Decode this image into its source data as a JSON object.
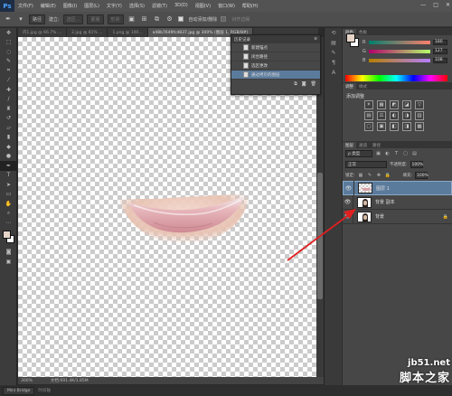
{
  "app": {
    "logo": "Ps"
  },
  "menu": [
    "文件(F)",
    "编辑(E)",
    "图像(I)",
    "图层(L)",
    "文字(Y)",
    "选择(S)",
    "滤镜(T)",
    "3D(D)",
    "视图(V)",
    "窗口(W)",
    "帮助(H)"
  ],
  "window_controls": [
    "—",
    "□",
    "✕"
  ],
  "options": {
    "mode": "路径",
    "make_label": "建立:",
    "btn_select": "选区...",
    "btn_mask": "蒙版",
    "btn_shape": "形状",
    "auto_add_delete": "自动添加/删除",
    "align_edges": "对齐边缘"
  },
  "tabs": [
    {
      "label": "内1.jpg @ 66.7% ...",
      "active": false
    },
    {
      "label": "2.jpg @ 81% ...",
      "active": false
    },
    {
      "label": "1.png @ 100...",
      "active": false
    },
    {
      "label": "a48b7649fcd837.jpg @ 300% (图层 1, RGB/8#)",
      "active": true
    }
  ],
  "status": {
    "zoom": "300%",
    "doc": "文档:691.4K/1.85M"
  },
  "bottom": {
    "mini_bridge": "Mini Bridge",
    "timeline": "时间轴"
  },
  "history": {
    "title": "历史记录",
    "items": [
      {
        "label": "新建锚点",
        "selected": false
      },
      {
        "label": "闭合路径",
        "selected": false
      },
      {
        "label": "选区更改",
        "selected": false
      },
      {
        "label": "通过拷贝的图层",
        "selected": true
      }
    ]
  },
  "color_panel": {
    "tabs": [
      "颜色",
      "色板"
    ],
    "r": "180",
    "g": "127",
    "b": "108"
  },
  "adjust_panel": {
    "tabs": [
      "调整",
      "样式"
    ],
    "title": "添加调整",
    "icons": [
      "☀",
      "▦",
      "◩",
      "◪",
      "▽",
      "▤",
      "⚖",
      "◐",
      "◑",
      "▥",
      "▢",
      "▣",
      "◧",
      "◨",
      "▩"
    ]
  },
  "layers_panel": {
    "tabs": [
      "图层",
      "通道",
      "路径"
    ],
    "kind": "ρ 类型",
    "blend": "正常",
    "opacity_label": "不透明度:",
    "opacity": "100%",
    "lock_label": "锁定:",
    "fill_label": "填充:",
    "fill": "100%",
    "layers": [
      {
        "name": "图层 1",
        "selected": true,
        "visible": true,
        "thumb": "lips"
      },
      {
        "name": "背景 副本",
        "selected": false,
        "visible": true,
        "thumb": "girl"
      },
      {
        "name": "背景",
        "selected": false,
        "visible": true,
        "thumb": "girl"
      }
    ]
  },
  "watermark": {
    "url": "jb51.net",
    "cn": "脚本之家"
  },
  "colors": {
    "accent": "#5b7b9c",
    "arrow": "#e02020"
  }
}
